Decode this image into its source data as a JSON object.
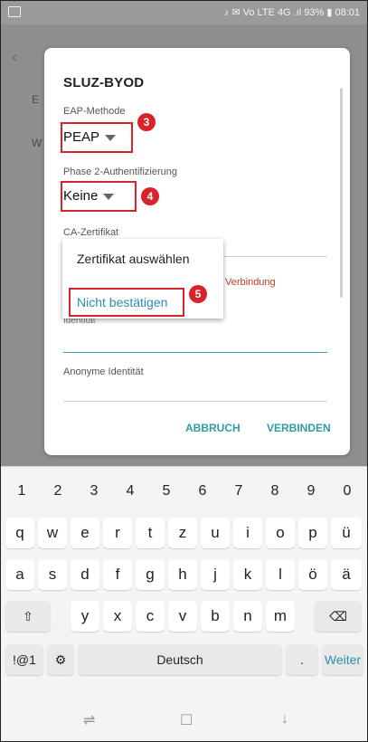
{
  "status": {
    "right_text": "♪ ✉ Vo LTE 4G .ıl 93% ▮ 08:01"
  },
  "background": {
    "letter_e": "E",
    "letter_w": "W"
  },
  "dialog": {
    "title": "SLUZ-BYOD",
    "eap_label": "EAP-Methode",
    "eap_value": "PEAP",
    "phase2_label": "Phase 2-Authentifizierung",
    "phase2_value": "Keine",
    "ca_label": "CA-Zertifikat",
    "ca_options": [
      "Zertifikat auswählen",
      "Nicht bestätigen"
    ],
    "warning_text": "Verbindung",
    "identity_label": "Identität",
    "anon_label": "Anonyme Identität",
    "cancel": "ABBRUCH",
    "connect": "VERBINDEN"
  },
  "markers": [
    "3",
    "4",
    "5"
  ],
  "keyboard": {
    "numbers": [
      "1",
      "2",
      "3",
      "4",
      "5",
      "6",
      "7",
      "8",
      "9",
      "0"
    ],
    "row1": [
      "q",
      "w",
      "e",
      "r",
      "t",
      "z",
      "u",
      "i",
      "o",
      "p",
      "ü"
    ],
    "row2": [
      "a",
      "s",
      "d",
      "f",
      "g",
      "h",
      "j",
      "k",
      "l",
      "ö",
      "ä"
    ],
    "row3": [
      "y",
      "x",
      "c",
      "v",
      "b",
      "n",
      "m"
    ],
    "symbols": "!@1",
    "space": "Deutsch",
    "period": ".",
    "go": "Weiter"
  },
  "colors": {
    "highlight": "#d8232a",
    "accent": "#2b8fb3"
  }
}
